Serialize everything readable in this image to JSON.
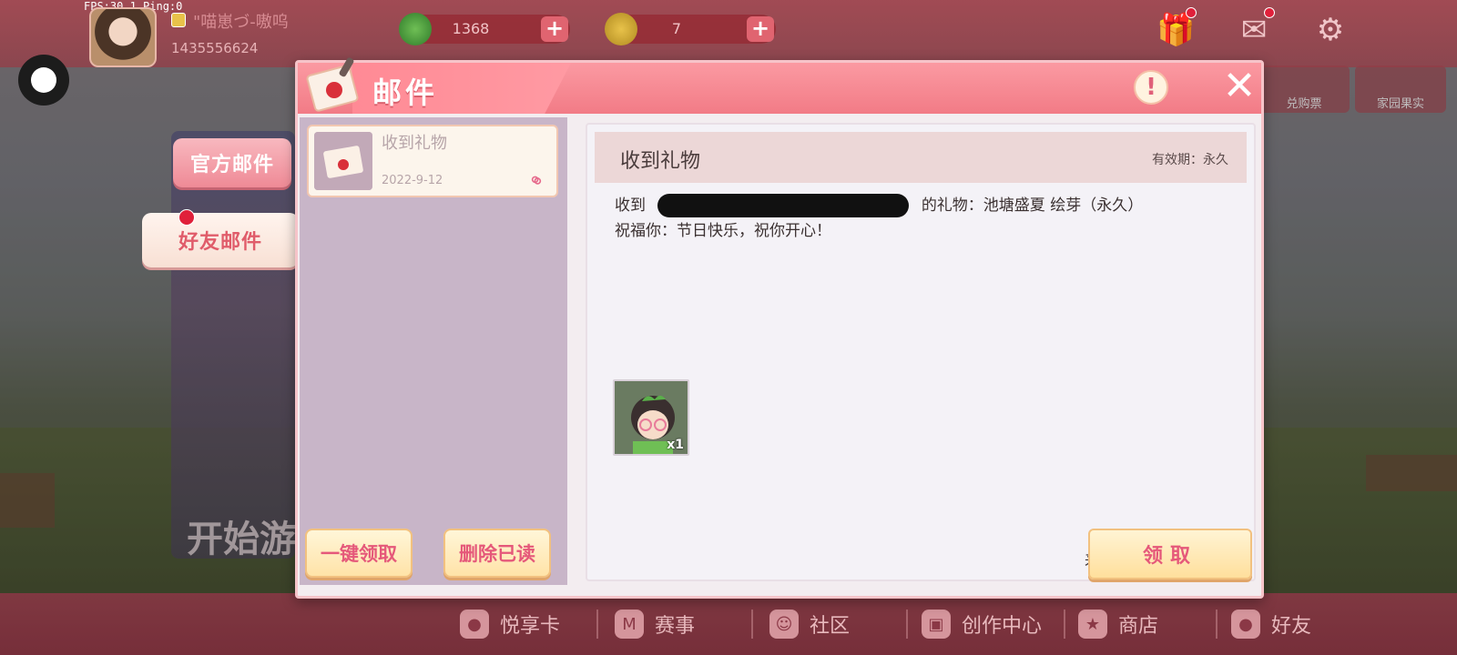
{
  "hud": {
    "fps_text": "FPS:30.1  Ping:0",
    "nickname": "\"喵崽づ-嗷呜",
    "uid": "1435556624",
    "gems": "1368",
    "coins": "7",
    "plus": "+"
  },
  "side_tabs": {
    "official": "官方邮件",
    "friend": "好友邮件"
  },
  "background": {
    "start_text": "开始游",
    "thumb_1": "兑购票",
    "thumb_2": "家园果实"
  },
  "bottom_nav": {
    "items": [
      {
        "label": "悦享卡",
        "icon": "pig-icon"
      },
      {
        "label": "赛事",
        "icon": "trophy-icon"
      },
      {
        "label": "社区",
        "icon": "community-icon"
      },
      {
        "label": "创作中心",
        "icon": "cube-icon"
      },
      {
        "label": "商店",
        "icon": "cart-icon"
      },
      {
        "label": "好友",
        "icon": "friend-icon"
      }
    ]
  },
  "dialog": {
    "title": "邮件",
    "info": "!",
    "close": "✕",
    "list": {
      "mail_subject": "收到礼物",
      "mail_date": "2022-9-12"
    },
    "buttons": {
      "claim_all": "一键领取",
      "delete_read": "删除已读",
      "claim": "领取"
    },
    "content": {
      "title": "收到礼物",
      "expire": "有效期：永久",
      "line1_prefix": "收到",
      "line1_suffix": "的礼物：池塘盛夏 绘芽（永久）",
      "line2": "祝福你：节日快乐，祝你开心！",
      "gift_count": "x1",
      "from_label": "来自"
    }
  }
}
